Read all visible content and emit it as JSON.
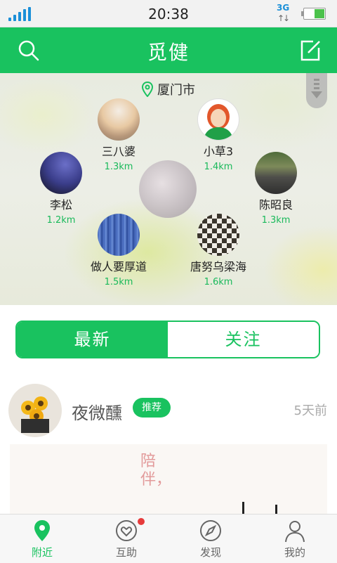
{
  "status_bar": {
    "time": "20:38",
    "network": "3G",
    "network_arrows": "↑↓"
  },
  "header": {
    "title": "觅健",
    "search_icon": "search-icon",
    "edit_icon": "compose-icon"
  },
  "map": {
    "city": "厦门市",
    "users": [
      {
        "name": "三八婆",
        "distance": "1.3km"
      },
      {
        "name": "小草3",
        "distance": "1.4km"
      },
      {
        "name": "李松",
        "distance": "1.2km"
      },
      {
        "name": "陈昭良",
        "distance": "1.3km"
      },
      {
        "name": "做人要厚道",
        "distance": "1.5km"
      },
      {
        "name": "唐努乌梁海",
        "distance": "1.6km"
      }
    ]
  },
  "tabs": [
    {
      "label": "最新",
      "active": true
    },
    {
      "label": "关注",
      "active": false
    }
  ],
  "post": {
    "username": "夜微醺",
    "badge": "推荐",
    "time": "5天前",
    "image_text": "陪伴，"
  },
  "bottom_nav": [
    {
      "label": "附近",
      "icon": "location-pin-icon",
      "active": true
    },
    {
      "label": "互助",
      "icon": "heart-refresh-icon",
      "badge": true
    },
    {
      "label": "发现",
      "icon": "compass-icon"
    },
    {
      "label": "我的",
      "icon": "person-icon"
    }
  ],
  "colors": {
    "accent": "#19c25f",
    "distance": "#19b95a",
    "badge_dot": "#e63b3b"
  }
}
